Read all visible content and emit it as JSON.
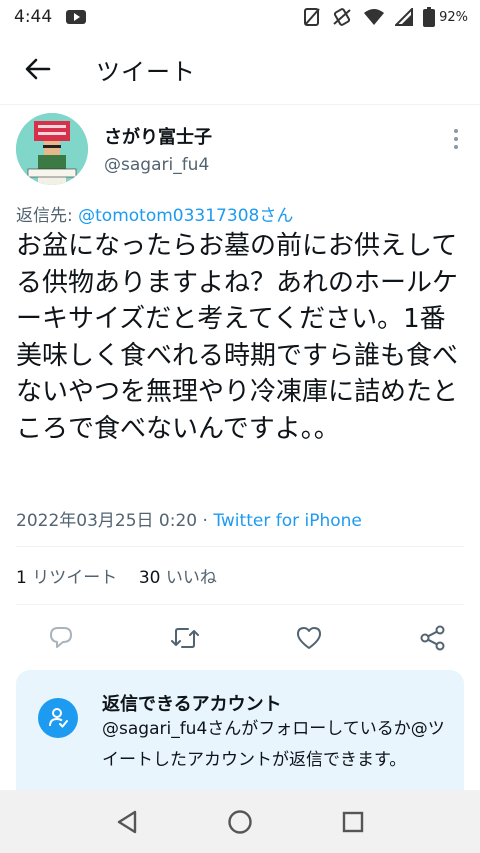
{
  "status_bar": {
    "time": "4:44",
    "battery_percent": "92%",
    "icons": [
      "youtube-icon",
      "no-sim-icon",
      "vibrate-icon",
      "wifi-icon",
      "signal-icon",
      "battery-icon"
    ]
  },
  "header": {
    "title": "ツイート",
    "back_icon": "arrow-left-icon"
  },
  "tweet": {
    "author_name": "さがり富士子",
    "author_handle": "@sagari_fu4",
    "reply_prefix": "返信先: ",
    "reply_mention": "@tomotom03317308さん",
    "text": "お盆になったらお墓の前にお供えしてる供物ありますよね？あれのホールケーキサイズだと考えてください。1番美味しく食べれる時期ですら誰も食べないやつを無理やり冷凍庫に詰めたところで食べないんですよ。。",
    "timestamp": "2022年03月25日 0:20",
    "separator": " · ",
    "source": "Twitter for iPhone",
    "retweet_count": "1",
    "retweet_label": "リツイート",
    "like_count": "30",
    "like_label": "いいね"
  },
  "actions": [
    "reply-icon",
    "retweet-icon",
    "like-icon",
    "share-icon"
  ],
  "reply_card": {
    "title": "返信できるアカウント",
    "body": "@sagari_fu4さんがフォローしているか@ツイートしたアカウントが返信できます。"
  },
  "colors": {
    "accent": "#1d9bf0",
    "secondary_text": "#536471",
    "card_bg": "#e8f5fd"
  }
}
